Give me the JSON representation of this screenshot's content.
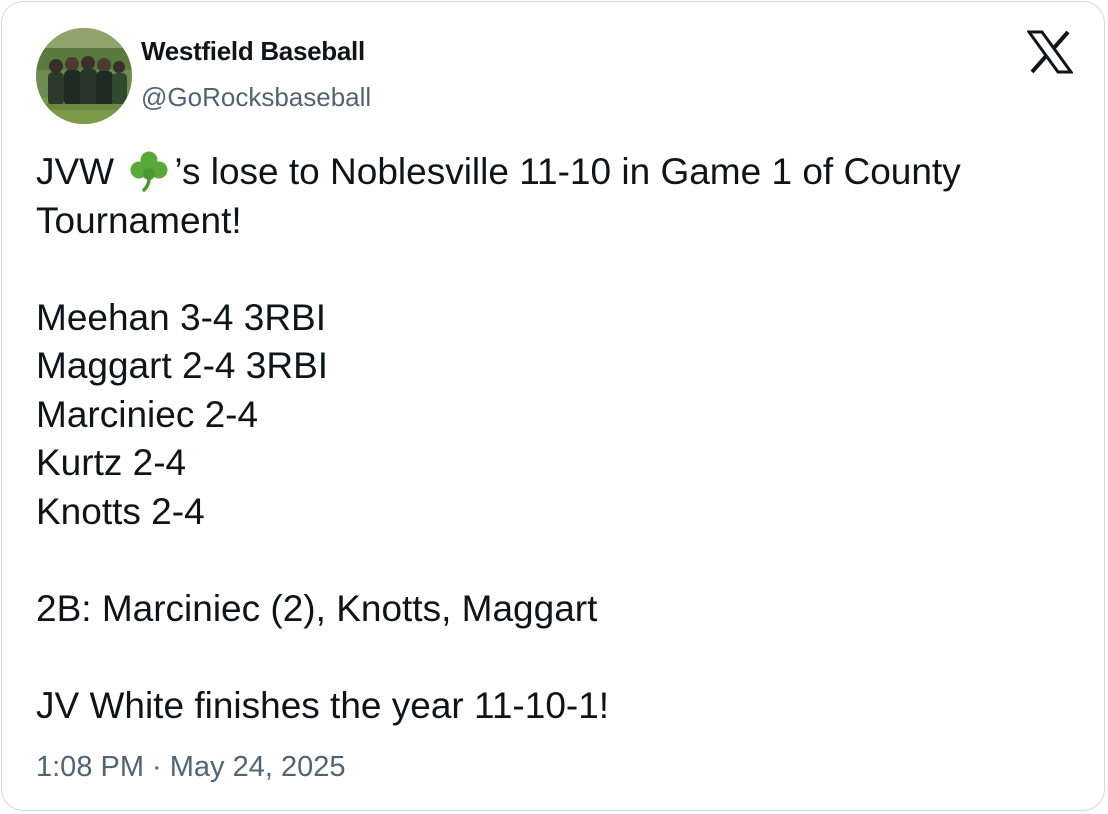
{
  "author": {
    "display_name": "Westfield Baseball",
    "handle": "@GoRocksbaseball",
    "avatar_icon": "team-photo-avatar"
  },
  "platform_icon": "x-logo-icon",
  "tweet": {
    "line1_pre": "JVW ",
    "line1_emoji": "shamrock-icon",
    "line1_post": "’s lose to Noblesville 11-10 in Game 1 of County",
    "line2": "Tournament!",
    "stats": [
      "Meehan 3-4 3RBI",
      "Maggart 2-4 3RBI",
      "Marciniec 2-4",
      "Kurtz 2-4",
      "Knotts 2-4"
    ],
    "doubles": "2B: Marciniec (2), Knotts, Maggart",
    "closing": "JV White finishes the year 11-10-1!"
  },
  "timestamp": "1:08 PM · May 24, 2025",
  "colors": {
    "text": "#0f1419",
    "secondary": "#536471",
    "border": "#cfd9de",
    "shamrock": "#5aa83a"
  }
}
